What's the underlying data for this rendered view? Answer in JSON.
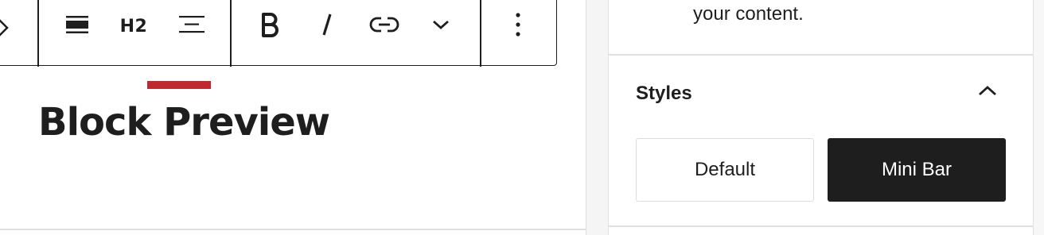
{
  "toolbar": {
    "heading_level_label": "H2",
    "buttons": [
      {
        "name": "move-arrows",
        "icon": "chevron-updown-icon"
      },
      {
        "name": "align-full",
        "icon": "align-full-icon"
      },
      {
        "name": "heading-level",
        "icon": "h2-text"
      },
      {
        "name": "text-align",
        "icon": "align-center-icon"
      },
      {
        "name": "bold",
        "icon": "bold-icon"
      },
      {
        "name": "italic",
        "icon": "italic-icon"
      },
      {
        "name": "link",
        "icon": "link-icon"
      },
      {
        "name": "more-formatting",
        "icon": "chevron-down-icon"
      },
      {
        "name": "options",
        "icon": "more-vertical-icon"
      }
    ]
  },
  "block": {
    "title": "Block Preview",
    "accent_color": "#c0282d"
  },
  "sidebar": {
    "description_tail": "your content.",
    "styles_panel": {
      "title": "Styles",
      "expanded": true,
      "options": [
        {
          "label": "Default",
          "selected": false
        },
        {
          "label": "Mini Bar",
          "selected": true
        }
      ]
    }
  }
}
